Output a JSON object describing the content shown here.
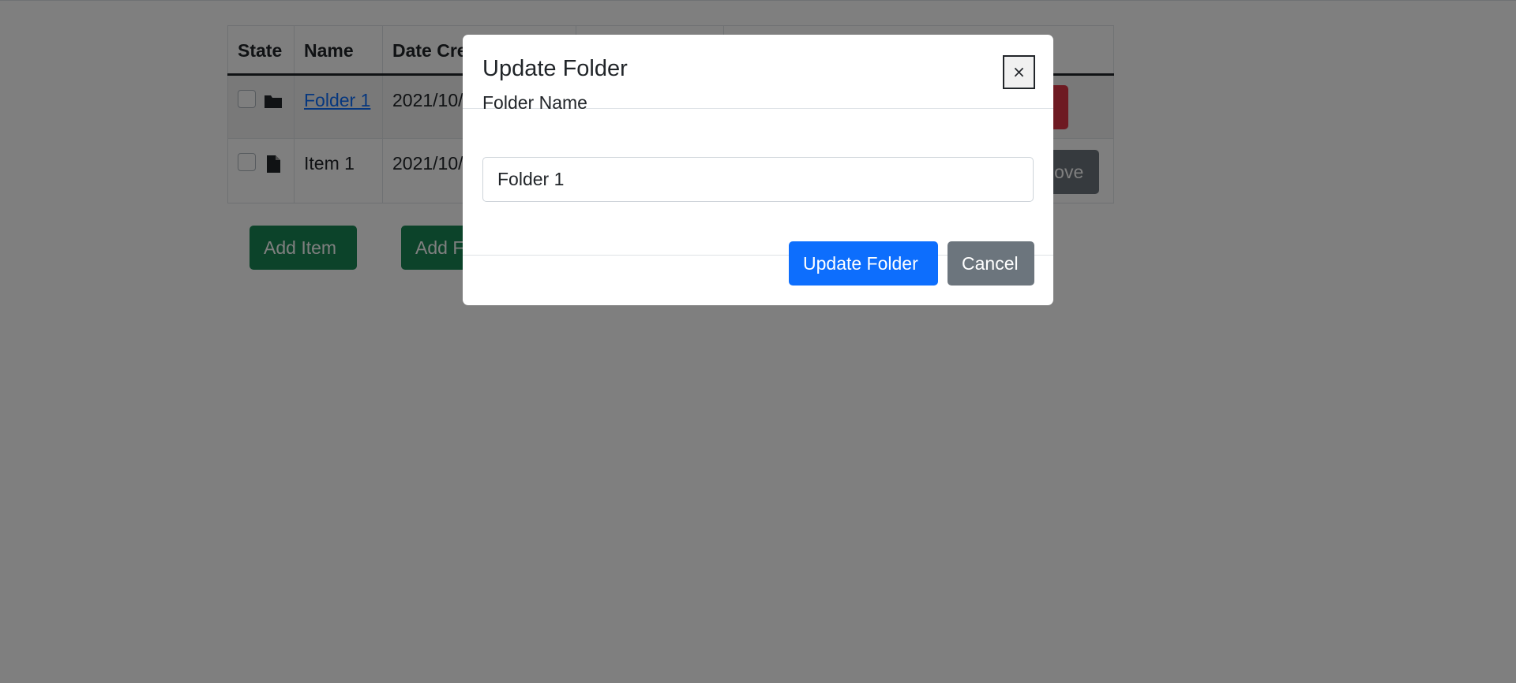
{
  "table": {
    "headers": {
      "state": "State",
      "name": "Name",
      "date_created": "Date Created",
      "date_modified": "",
      "actions": ""
    },
    "rows": [
      {
        "type": "folder",
        "name": "Folder 1",
        "date_created": "2021/10/",
        "action_label": ""
      },
      {
        "type": "item",
        "name": "Item 1",
        "date_created": "2021/10/",
        "action_label": "Move"
      }
    ]
  },
  "actions": {
    "add_item": "Add Item",
    "add_folder": "Add Folder"
  },
  "modal": {
    "title": "Update Folder",
    "close_symbol": "×",
    "field_label": "Folder Name",
    "field_value": "Folder 1",
    "submit_label": "Update Folder",
    "cancel_label": "Cancel"
  },
  "colors": {
    "primary": "#0d6efd",
    "secondary": "#6c757d",
    "success": "#198754",
    "danger": "#dc3545",
    "overlay": "rgba(0,0,0,0.5)"
  },
  "icons": {
    "folder": "folder-icon",
    "file": "file-icon"
  }
}
